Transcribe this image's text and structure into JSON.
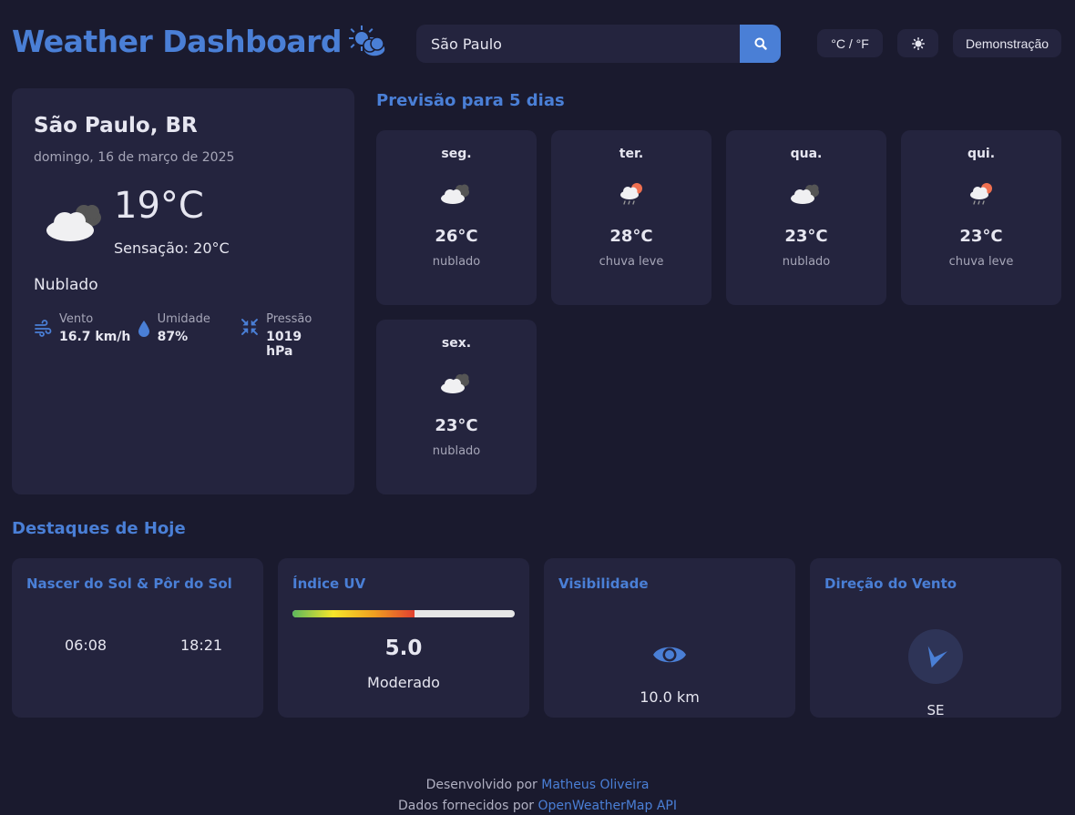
{
  "header": {
    "title": "Weather Dashboard",
    "search_value": "São Paulo",
    "unit_toggle_label": "°C / °F",
    "demo_label": "Demonstração"
  },
  "current": {
    "city": "São Paulo, BR",
    "date": "domingo, 16 de março de 2025",
    "temp": "19°C",
    "feels_like": "Sensação: 20°C",
    "description": "Nublado",
    "wind_label": "Vento",
    "wind_value": "16.7 km/h",
    "humidity_label": "Umidade",
    "humidity_value": "87%",
    "pressure_label": "Pressão",
    "pressure_value": "1019 hPa"
  },
  "forecast": {
    "title": "Previsão para 5 dias",
    "days": [
      {
        "day": "seg.",
        "temp": "26°C",
        "desc": "nublado",
        "icon": "cloudy-icon"
      },
      {
        "day": "ter.",
        "temp": "28°C",
        "desc": "chuva leve",
        "icon": "light-rain-icon"
      },
      {
        "day": "qua.",
        "temp": "23°C",
        "desc": "nublado",
        "icon": "cloudy-icon"
      },
      {
        "day": "qui.",
        "temp": "23°C",
        "desc": "chuva leve",
        "icon": "light-rain-icon"
      },
      {
        "day": "sex.",
        "temp": "23°C",
        "desc": "nublado",
        "icon": "cloudy-icon"
      }
    ]
  },
  "highlights": {
    "title": "Destaques de Hoje",
    "sun_title": "Nascer do Sol & Pôr do Sol",
    "sunrise": "06:08",
    "sunset": "18:21",
    "uv_title": "Índice UV",
    "uv_value": "5.0",
    "uv_level": "Moderado",
    "uv_fraction": 0.55,
    "visibility_title": "Visibilidade",
    "visibility_value": "10.0 km",
    "wind_dir_title": "Direção do Vento",
    "wind_dir_value": "SE"
  },
  "footer": {
    "dev_prefix": "Desenvolvido por",
    "dev_name": "Matheus Oliveira",
    "data_prefix": "Dados fornecidos por",
    "data_source": "OpenWeatherMap API"
  },
  "colors": {
    "background": "#1a1a2e",
    "card": "#24243e",
    "accent": "#4a7fd6",
    "text": "#e6e6f0",
    "muted": "#a6a6b8"
  }
}
